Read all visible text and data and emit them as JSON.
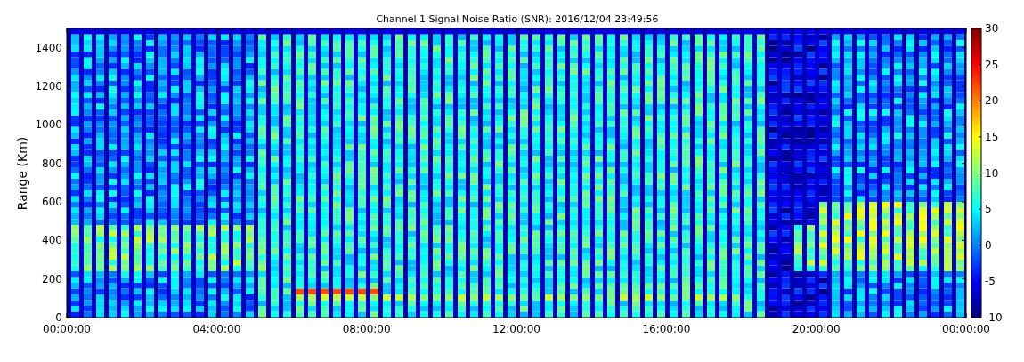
{
  "title": "Channel 1 Signal Noise Ratio (SNR): 2016/12/04 23:49:56",
  "y_axis": {
    "label": "Range (Km)",
    "ticks": [
      "1400",
      "1200",
      "1000",
      "800",
      "600",
      "400",
      "200",
      "0"
    ]
  },
  "x_axis": {
    "ticks": [
      "00:00:00",
      "04:00:00",
      "08:00:00",
      "12:00:00",
      "16:00:00",
      "20:00:00",
      "00:00:00"
    ]
  },
  "colorbar": {
    "ticks": [
      "30",
      "25",
      "20",
      "15",
      "10",
      "5",
      "0",
      "-5",
      "-10"
    ]
  }
}
